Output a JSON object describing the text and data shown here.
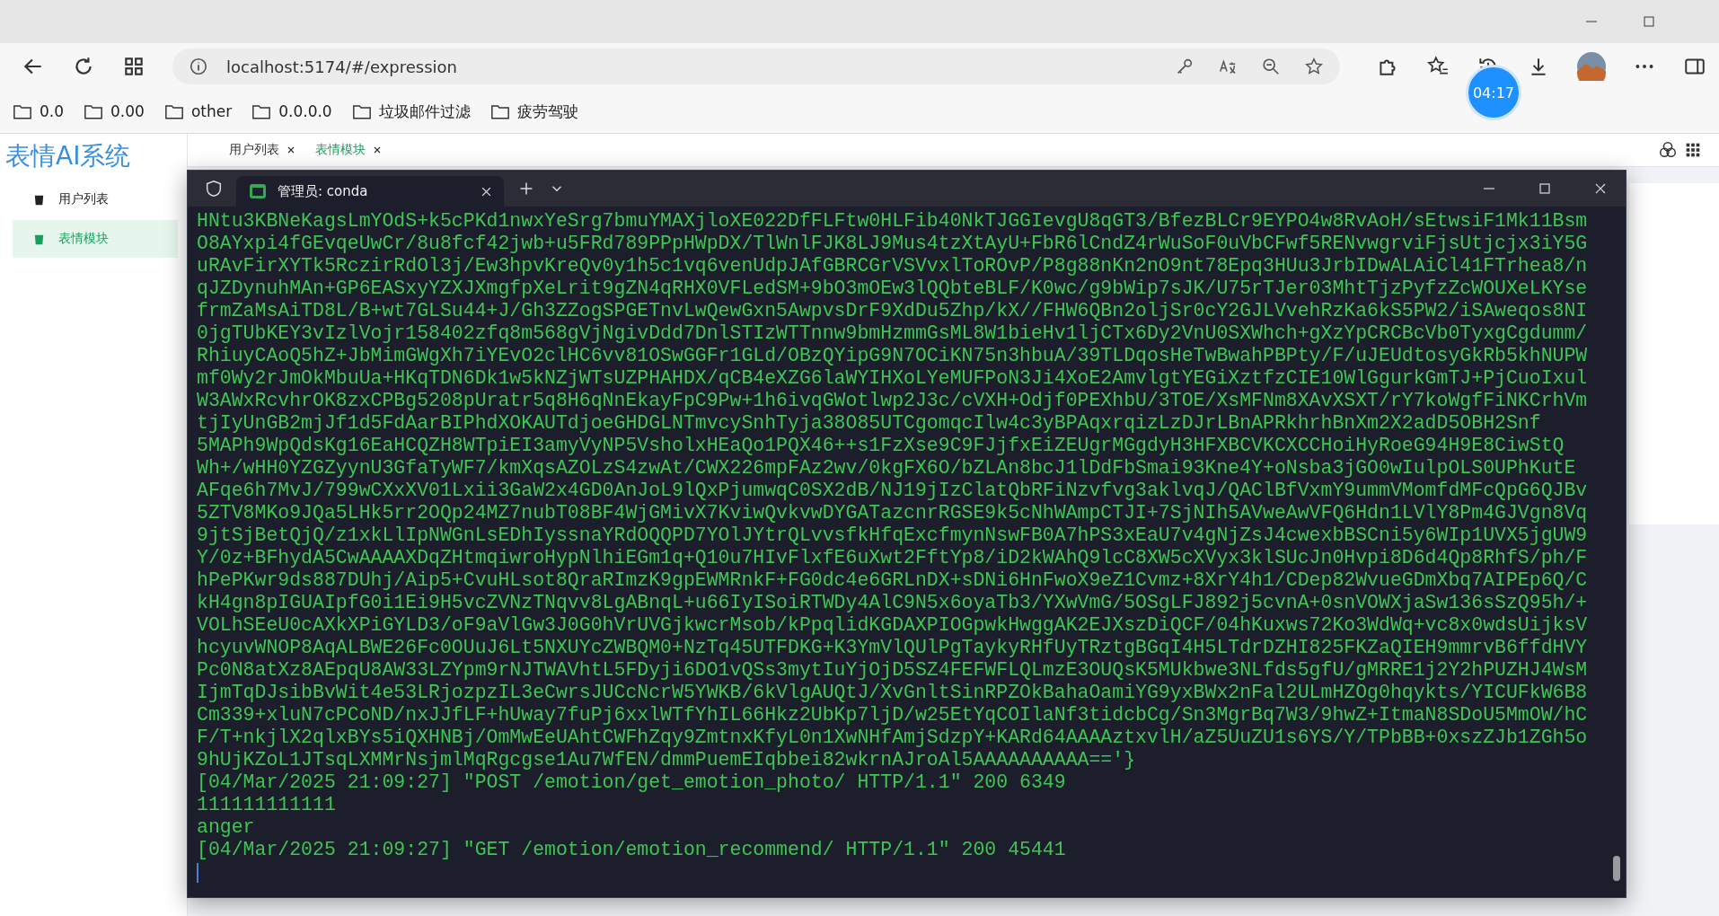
{
  "address_bar": {
    "url": "localhost:5174/#/expression"
  },
  "bookmarks": [
    {
      "label": "0.0"
    },
    {
      "label": "0.00"
    },
    {
      "label": "other"
    },
    {
      "label": "0.0.0.0"
    },
    {
      "label": "垃圾邮件过滤"
    },
    {
      "label": "疲劳驾驶"
    }
  ],
  "app": {
    "title": "表情AI系统",
    "sidebar": [
      {
        "label": "用户列表",
        "selected": false
      },
      {
        "label": "表情模块",
        "selected": true
      }
    ],
    "tabs": [
      {
        "label": "用户列表",
        "selected": false
      },
      {
        "label": "表情模块",
        "selected": true
      }
    ]
  },
  "terminal": {
    "tab_title": "管理员: conda",
    "lines": [
      "HNtu3KBNeKagsLmYOdS+k5cPKd1nwxYeSrg7bmuYMAXjloXE022DfFLFtw0HLFib40NkTJGGIevgU8qGT3/BfezBLCr9EYPO4w8RvAoH/sEtwsiF1Mk11Bsm",
      "O8AYxpi4fGEvqeUwCr/8u8fcf42jwb+u5FRd789PPpHWpDX/TlWnlFJK8LJ9Mus4tzXtAyU+FbR6lCndZ4rWuSoF0uVbCFwf5RENvwgrviFjsUtjcjx3iY5G",
      "uRAvFirXYTk5RczirRdOl3j/Ew3hpvKreQv0y1h5c1vq6venUdpJAfGBRCGrVSVvxlToROvP/P8g88nKn2nO9nt78Epq3HUu3JrbIDwALAiCl41FTrhea8/n",
      "qJZDynuhMAn+GP6EASxyYZXJXmgfpXeLrit9gZN4qRHX0VFLedSM+9bO3mOEw3lQQbteBLF/K0wc/g9bWip7sJK/U75rTJer03MhtTjzPyfzZcWOUXeLKYse",
      "frmZaMsAiTD8L/B+wt7GLSu44+J/Gh3ZZogSPGETnvLwQewGxn5AwpvsDrF9XdDu5Zhp/kX//FHW6QBn2oljSr0cY2GJLVvehRzKa6kS5PW2/iSAweqos8NI",
      "0jgTUbKEY3vIzlVojr158402zfq8m568gVjNgivDdd7DnlSTIzWTTnnw9bmHzmmGsML8W1bieHv1ljCTx6Dy2VnU0SXWhch+gXzYpCRCBcVb0TyxgCgdumm/",
      "RhiuyCAoQ5hZ+JbMimGWgXh7iYEvO2clHC6vv81OSwGGFr1GLd/OBzQYipG9N7OCiKN75n3hbuA/39TLDqosHeTwBwahPBPty/F/uJEUdtosyGkRb5khNUPW",
      "mf0Wy2rJmOkMbuUa+HKqTDN6Dk1w5kNZjWTsUZPHAHDX/qCB4eXZG6laWYIHXoLYeMUFPoN3Ji4XoE2AmvlgtYEGiXztfzCIE10WlGgurkGmTJ+PjCuoIxul",
      "W3AWxRcvhrOK8zxCPBg5208pUratr5q8H6qNnEkayFpC9Pw+1h6ivqGWotlwp2J3c/cVXH+Odjf0PEXhbU/3TOE/XsMFNm8XAvXSXT/rY7koWgfFiNKCrhVm",
      "tjIyUnGB2mjJf1d5FdAarBIPhdXOKAUTdjoeGHDGLNTmvcySnhTyja38O85UTCgomqcIlw4c3yBPAqxrqizLzDJrLBnAPRkhrhBnXm2X2adD5OBH2Snf",
      "5MAPh9WpQdsKg16EaHCQZH8WTpiEI3amyVyNP5VsholxHEaQo1PQX46++s1FzXse9C9FJjfxEiZEUgrMGgdyH3HFXBCVKCXCCHoiHyRoeG94H9E8CiwStQ",
      "Wh+/wHH0YZGZyynU3GfaTyWF7/kmXqsAZOLzS4zwAt/CWX226mpFAz2wv/0kgFX6O/bZLAn8bcJ1lDdFbSmai93Kne4Y+oNsba3jGO0wIulpOLS0UPhKutE",
      "AFqe6h7MvJ/799wCXxXV01Lxii3GaW2x4GD0AnJoL9lQxPjumwqC0SX2dB/NJ19jIzClatQbRFiNzvfvg3aklvqJ/QAClBfVxmY9ummVMomfdMFcQpG6QJBv",
      "5ZTV8MKo9JQa5LHk5rr2OQp24MZ7nubT08BF4WjGMivX7KviwQvkvwDYGATazcnrRGSE9k5cNhWAmpCTJI+7SjNIh5AVweAwVFQ6Hdn1LVlY8Pm4GJVgn8Vq",
      "9jtSjBetQjQ/z1xkLlIpNWGnLsEDhIyssnaYRdOQQPD7YOlJYtrQLvvsfkHfqExcfmynNswFB0A7hPS3xEaU7v4gNjZsJ4cwexbBSCni5y6WIp1UVX5jgUW9",
      "Y/0z+BFhydA5CwAAAAXDqZHtmqiwroHypNlhiEGm1q+Q10u7HIvFlxfE6uXwt2FftYp8/iD2kWAhQ9lcC8XW5cXVyx3klSUcJn0Hvpi8D6d4Qp8RhfS/ph/F",
      "hPePKwr9ds887DUhj/Aip5+CvuHLsot8QraRImzK9gpEWMRnkF+FG0dc4e6GRLnDX+sDNi6HnFwoX9eZ1Cvmz+8XrY4h1/CDep82WvueGDmXbq7AIPEp6Q/C",
      "kH4gn8pIGUAIpfG0i1Ei9H5vcZVNzTNqvv8LgABnqL+u66IyISoiRTWDy4AlC9N5x6oyaTb3/YXwVmG/5OSgLFJ892j5cvnA+0snVOWXjaSw136sSzQ95h/+",
      "VOLhSEeU0cAXkXPiGYLD3/oF9aVlGw3J0G0hVrUVGjkwcrMsob/kPpqlidKGDAXPIOGpwkHwggAK2EJXszDiQCF/04hKuxws72Ko3WdWq+vc8x0wdsUijksV",
      "hcyuvWNOP8AqALBWE26Fc0OUuJ6Lt5NXUYcZWBQM0+NzTq45UTFDKG+K3YmVlQUlPgTaykyRHfUyTRztgBGqI4H5LTdrDZHI825FKZaQIEH9mmrvB6ffdHVY",
      "Pc0N8atXz8AEpqU8AW33LZYpm9rNJTWAVhtL5FDyji6DO1vQSs3mytIuYjOjD5SZ4FEFWFLQLmzE3OUQsK5MUkbwe3NLfds5gfU/gMRRE1j2Y2hPUZHJ4WsM",
      "IjmTqDJsibBvWit4e53LRjozpzIL3eCwrsJUCcNcrW5YWKB/6kVlgAUQtJ/XvGnltSinRPZOkBahaOamiYG9yxBWx2nFal2ULmHZOg0hqykts/YICUFkW6B8",
      "Cm339+xluN7cPCoND/nxJJfLF+hUway7fuPj6xxlWTfYhIL66Hkz2UbKp7ljD/w25EtYqCOIlaNf3tidcbCg/Sn3MgrBq7W3/9hwZ+ItmaN8SDoU5MmOW/hC",
      "F/T+nkjlX2qlxBYs5iQXHNBj/OmMwEeUAhtCWFhZqy9ZmtnxKfyL0n1XwNHfAmjSdzpY+KARd64AAAAztxvlH/aZ5UuZU1s6YS/Y/TPbBB+0xszZJb1ZGh5o",
      "9hUjKZoL1JTsqLXMMrNsjmlMqRgcgse1Au7WfEN/dmmPuemEIqbbei82wkrnAJroAl5AAAAAAAAAA=='}",
      "[04/Mar/2025 21:09:27] \"POST /emotion/get_emotion_photo/ HTTP/1.1\" 200 6349",
      "111111111111",
      "anger",
      "[04/Mar/2025 21:09:27] \"GET /emotion/emotion_recommend/ HTTP/1.1\" 200 45441"
    ]
  },
  "recorder": {
    "time": "04:17"
  }
}
